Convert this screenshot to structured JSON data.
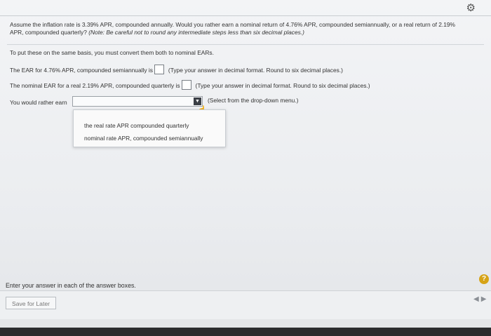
{
  "question": {
    "text": "Assume the inflation rate is 3.39% APR, compounded annually. Would you rather earn a nominal return of 4.76% APR, compounded semiannually, or a real return of 2.19% APR, compounded quarterly?",
    "note": "(Note: Be careful not to round any intermediate steps less than six decimal places.)"
  },
  "instruction": "To put these on the same basis, you must convert them both to nominal EARs.",
  "lines": {
    "ear_semiannual_label": "The EAR for 4.76% APR, compounded semiannually is",
    "ear_semiannual_hint": "(Type your answer in decimal format. Round to six decimal places.)",
    "ear_quarterly_label": "The nominal EAR for a real 2.19% APR, compounded quarterly is",
    "ear_quarterly_hint": "(Type your answer in decimal format. Round to six decimal places.)",
    "rather_label": "You would rather earn",
    "rather_hint": "(Select from the drop-down menu.)"
  },
  "dropdown": {
    "selected": "",
    "options": [
      "the real rate APR compounded quarterly",
      "nominal rate APR, compounded semiannually"
    ]
  },
  "footer": {
    "message": "Enter your answer in each of the answer boxes.",
    "save_label": "Save for Later",
    "help_label": "?",
    "prev_icon": "◀",
    "next_icon": "▶"
  },
  "icons": {
    "gear": "⚙"
  }
}
